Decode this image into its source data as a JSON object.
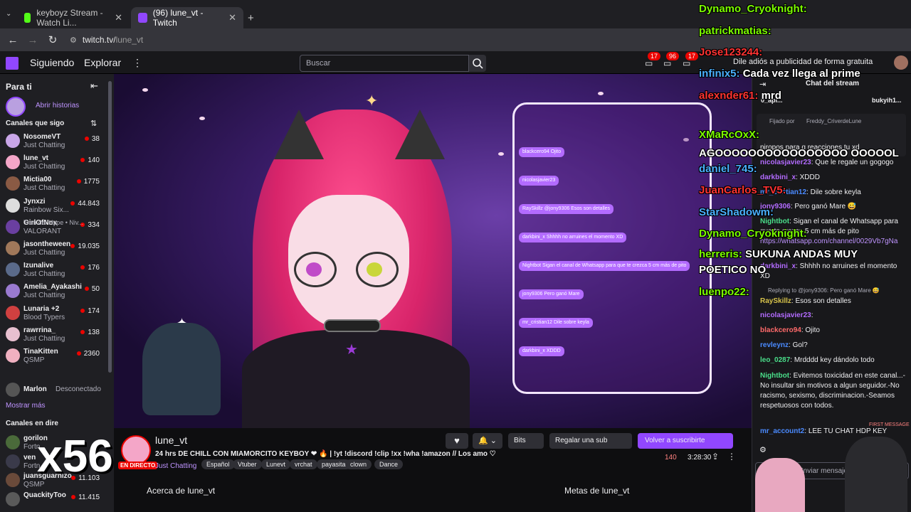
{
  "browser": {
    "tabs": [
      {
        "label": "keyboyz Stream - Watch Li..."
      },
      {
        "label": "(96) lune_vt - Twitch"
      }
    ],
    "url_scheme": "twitch.tv/",
    "url_path": "lune_vt"
  },
  "topnav": {
    "following": "Siguiendo",
    "explore": "Explorar",
    "search_placeholder": "Buscar",
    "badges": [
      "17",
      "96",
      "17"
    ],
    "ad_free": "Dile adiós a publicidad de forma gratuita"
  },
  "sidebar": {
    "for_you": "Para ti",
    "open_stories": "Abrir historias",
    "followed_header": "Canales que sigo",
    "channels": [
      {
        "name": "NosomeVT",
        "game": "Just Chatting",
        "viewers": "38",
        "color": "#c9a6e8"
      },
      {
        "name": "lune_vt",
        "game": "Just Chatting",
        "viewers": "140",
        "color": "#f4a6c8"
      },
      {
        "name": "Mictia00",
        "game": "Just Chatting",
        "viewers": "1775",
        "color": "#8a5a44"
      },
      {
        "name": "Jynxzi",
        "game": "Rainbow Six...",
        "viewers": "44.843",
        "color": "#ddd"
      },
      {
        "name": "GirlOfNox",
        "game": "VALORANT",
        "viewers": "334",
        "color": "#6a3fa0"
      },
      {
        "name": "jasontheween",
        "game": "Just Chatting",
        "viewers": "19.035",
        "color": "#a0785a"
      },
      {
        "name": "Izunalive",
        "game": "Just Chatting",
        "viewers": "176",
        "color": "#5a6a8a"
      },
      {
        "name": "Amelia_Ayakashi",
        "game": "Just Chatting",
        "viewers": "50",
        "color": "#9a7ad0"
      },
      {
        "name": "Lunaria +2",
        "game": "Blood Typers",
        "viewers": "174",
        "color": "#d04040"
      },
      {
        "name": "rawrrina_",
        "game": "Just Chatting",
        "viewers": "138",
        "color": "#e8c0d0"
      },
      {
        "name": "TinaKitten",
        "game": "QSMP",
        "viewers": "2360",
        "color": "#f0b0c0"
      }
    ],
    "jynxzi_sub": "Tren del Hype • Niv...",
    "offline_name": "Marlon",
    "offline_status": "Desconectado",
    "show_more": "Mostrar más",
    "live_header": "Canales en dire",
    "live_channels": [
      {
        "name": "gorilon",
        "game": "Fortn",
        "color": "#4a6a3a"
      },
      {
        "name": "ven",
        "game": "Fortn",
        "color": "#3a3a4a"
      },
      {
        "name": "juansguarnizo",
        "game": "QSMP",
        "viewers": "11.103",
        "color": "#6a4a3a"
      },
      {
        "name": "QuackityToo",
        "game": "",
        "viewers": "11.415",
        "color": "#5a5a5a"
      }
    ],
    "combo": "x56"
  },
  "overlay_chat": [
    {
      "user": "Dynamo_Cryoknight:",
      "msg": "",
      "color": "#7CFC00"
    },
    {
      "user": "patrickmatias:",
      "msg": "",
      "color": "#7CFC00"
    },
    {
      "user": "Jose123244:",
      "msg": "",
      "color": "#ff3333"
    },
    {
      "user": "infinix5:",
      "msg": "Cada vez llega al prime",
      "color": "#4ab0ff"
    },
    {
      "user": "alexnder61:",
      "msg": "mrd",
      "color": "#ff3333"
    },
    {
      "user": "XMaRcOxX:",
      "msg": "AGOOOOOOOOOOOOOOOO OOOOOL",
      "color": "#7CFC00"
    },
    {
      "user": "daniel_745:",
      "msg": "",
      "color": "#4ab0ff"
    },
    {
      "user": "JuanCarlos_TV5:",
      "msg": "",
      "color": "#ff3333"
    },
    {
      "user": "StarShadowm:",
      "msg": "",
      "color": "#4ab0ff"
    },
    {
      "user": "Dynamo_Cryoknight:",
      "msg": "",
      "color": "#7CFC00"
    },
    {
      "user": "herreris:",
      "msg": "SUKUNA ANDAS MUY",
      "color": "#7CFC00"
    },
    {
      "user": "",
      "msg": "POETICO NO",
      "color": "#fff"
    },
    {
      "user": "luenpo22:",
      "msg": "",
      "color": "#7CFC00"
    }
  ],
  "video_frame_msgs": [
    "blackcero94  Ojito",
    "nicolasjavier23",
    "RaySkillz  @jony9306 Esos son detalles",
    "darkbini_x  Shhhh no arruines el momento XD",
    "Nightbot  Sigan el canal de Whatsapp para que te crezca 5 cm más de pito",
    "jony9306  Pero ganó Mare",
    "mr_cristian12  Dile sobre keyla",
    "darkbini_x  XDDD"
  ],
  "stream": {
    "channel": "lune_vt",
    "live_badge": "EN DIRECTO",
    "title": "24 hrs DE CHILL CON MIAMORCITO KEYBOY ❤ 🔥 | !yt !discord !clip !xx !wha !amazon // Los amo ♡",
    "category": "Just Chatting",
    "tags": [
      "Español",
      "Vtuber",
      "Lunevt",
      "vrchat",
      "payasita",
      "clown",
      "Dance"
    ],
    "viewers": "140",
    "uptime": "3:28:30",
    "bits": "Bits",
    "gift": "Regalar una sub",
    "subscribe": "Volver a suscribirte",
    "about": "Acerca de lune_vt",
    "goals": "Metas de lune_vt"
  },
  "chat": {
    "header": "Chat del stream",
    "top_gifters": [
      "0_api...",
      "bukyih1..."
    ],
    "pinned_by": "Fijado por",
    "pinned_user": "Freddy_CriverdeLune",
    "pinned_msg": "piropos para q reacciones tu xd",
    "messages": [
      {
        "user": "nicolasjavier23",
        "msg": "Que le regale un gogogo",
        "color": "#b36bff"
      },
      {
        "user": "darkbini_x",
        "msg": "XDDD",
        "color": "#b36bff"
      },
      {
        "user": "mr_cristian12",
        "msg": "Dile sobre keyla",
        "color": "#4a8aff"
      },
      {
        "user": "jony9306",
        "msg": "Pero ganó Mare 😅",
        "color": "#b36bff"
      },
      {
        "user": "Nightbot",
        "msg": "Sigan el canal de Whatsapp para que te crezca 5 cm más de pito",
        "color": "#4adf8a"
      },
      {
        "user": "",
        "msg": "https://whatsapp.com/channel/0029Vb7gNa",
        "color": "#bf94ff"
      },
      {
        "user": "darkbini_x",
        "msg": "Shhhh no arruines el momento XD",
        "color": "#b36bff"
      },
      {
        "user": "RaySkillz",
        "msg": "Esos son detalles",
        "color": "#d6c24a"
      },
      {
        "user": "nicolasjavier23",
        "msg": "",
        "color": "#b36bff"
      },
      {
        "user": "blackcero94",
        "msg": "Ojito",
        "color": "#ff6a6a"
      },
      {
        "user": "revleynz",
        "msg": "Gol?",
        "color": "#4a8aff"
      },
      {
        "user": "leo_0287",
        "msg": "Mrdddd key dándolo todo",
        "color": "#4adf8a"
      },
      {
        "user": "Nightbot",
        "msg": "Evitemos toxicidad en este canal...-No insultar sin motivos a algun seguidor.-No racismo, sexismo, discriminacion.-Seamos respetuosos con todos.",
        "color": "#4adf8a"
      },
      {
        "user": "mr_account2",
        "msg": "LEE TU CHAT HDP KEY",
        "color": "#4a8aff"
      }
    ],
    "reply_note": "Replying to @jony9306: Pero ganó Mare 😅",
    "first_message": "FIRST MESSAGE",
    "input_placeholder": "Enviar mensaje"
  }
}
